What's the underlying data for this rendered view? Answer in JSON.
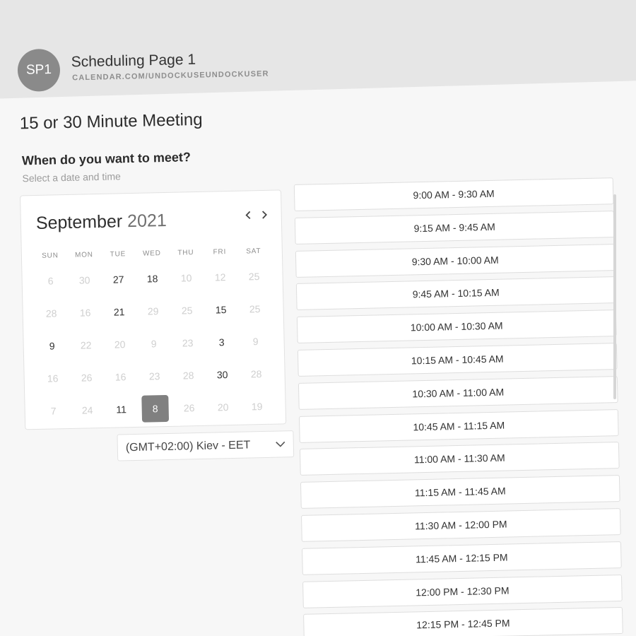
{
  "header": {
    "avatar_initials": "SP1",
    "page_name": "Scheduling Page 1",
    "page_url": "CALENDAR.COM/UNDOCKUSEUNDOCKUSER"
  },
  "meeting": {
    "title": "15 or 30 Minute Meeting",
    "question": "When do you want to meet?",
    "hint": "Select a date and time"
  },
  "calendar": {
    "month": "September",
    "year": "2021",
    "prev_icon": "chevron-left-icon",
    "next_icon": "chevron-right-icon",
    "weekdays": [
      "SUN",
      "MON",
      "TUE",
      "WED",
      "THU",
      "FRI",
      "SAT"
    ],
    "weeks": [
      [
        {
          "d": "6",
          "a": false
        },
        {
          "d": "30",
          "a": false
        },
        {
          "d": "27",
          "a": true
        },
        {
          "d": "18",
          "a": true
        },
        {
          "d": "10",
          "a": false
        },
        {
          "d": "12",
          "a": false
        },
        {
          "d": "25",
          "a": false
        }
      ],
      [
        {
          "d": "28",
          "a": false
        },
        {
          "d": "16",
          "a": false
        },
        {
          "d": "21",
          "a": true
        },
        {
          "d": "29",
          "a": false
        },
        {
          "d": "25",
          "a": false
        },
        {
          "d": "15",
          "a": true
        },
        {
          "d": "25",
          "a": false
        }
      ],
      [
        {
          "d": "9",
          "a": true
        },
        {
          "d": "22",
          "a": false
        },
        {
          "d": "20",
          "a": false
        },
        {
          "d": "9",
          "a": false
        },
        {
          "d": "23",
          "a": false
        },
        {
          "d": "3",
          "a": true
        },
        {
          "d": "9",
          "a": false
        }
      ],
      [
        {
          "d": "16",
          "a": false
        },
        {
          "d": "26",
          "a": false
        },
        {
          "d": "16",
          "a": false
        },
        {
          "d": "23",
          "a": false
        },
        {
          "d": "28",
          "a": false
        },
        {
          "d": "30",
          "a": true
        },
        {
          "d": "28",
          "a": false
        }
      ],
      [
        {
          "d": "7",
          "a": false
        },
        {
          "d": "24",
          "a": false
        },
        {
          "d": "11",
          "a": true
        },
        {
          "d": "8",
          "a": true,
          "selected": true
        },
        {
          "d": "26",
          "a": false
        },
        {
          "d": "20",
          "a": false
        },
        {
          "d": "19",
          "a": false
        }
      ]
    ]
  },
  "timezone": {
    "selected": "(GMT+02:00) Kiev - EET",
    "icon": "chevron-down-icon"
  },
  "time_slots": [
    "9:00 AM - 9:30 AM",
    "9:15 AM - 9:45 AM",
    "9:30 AM - 10:00 AM",
    "9:45 AM - 10:15 AM",
    "10:00 AM - 10:30 AM",
    "10:15 AM - 10:45 AM",
    "10:30 AM - 11:00 AM",
    "10:45 AM - 11:15 AM",
    "11:00 AM - 11:30 AM",
    "11:15 AM - 11:45 AM",
    "11:30 AM - 12:00 PM",
    "11:45 AM - 12:15 PM",
    "12:00 PM - 12:30 PM",
    "12:15 PM - 12:45 PM"
  ],
  "colors": {
    "selected_day": "#808080",
    "header_bg": "#e6e6e6",
    "avatar_bg": "#8a8a8a"
  }
}
